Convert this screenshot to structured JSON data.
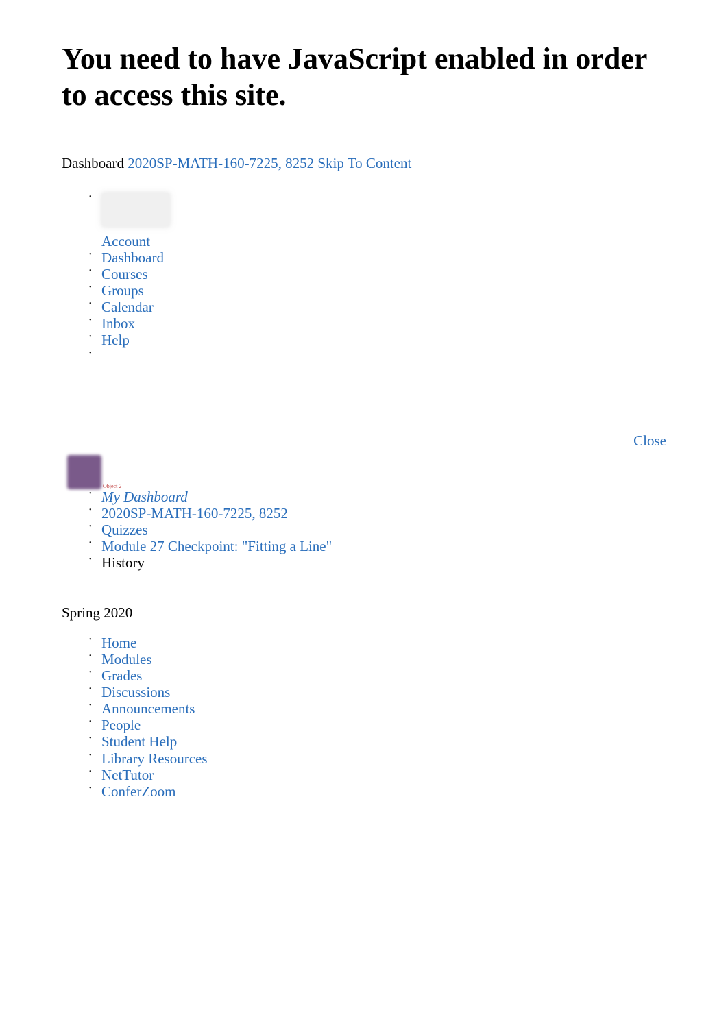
{
  "heading": "You need to have JavaScript enabled in order to access this site.",
  "top_line": {
    "dashboard": "Dashboard",
    "course_code": "2020SP-MATH-160-7225, 8252",
    "skip_link": "Skip To Content"
  },
  "main_nav": {
    "account": "Account",
    "dashboard": "Dashboard",
    "courses": "Courses",
    "groups": "Groups",
    "calendar": "Calendar",
    "inbox": "Inbox",
    "help": "Help"
  },
  "close_label": "Close",
  "object_label": "Object 2",
  "breadcrumb": {
    "my_dashboard": "My Dashboard",
    "course_code": "2020SP-MATH-160-7225, 8252",
    "quizzes": "Quizzes",
    "module_checkpoint": "Module 27 Checkpoint: \"Fitting a Line\"",
    "history": "History"
  },
  "term": "Spring 2020",
  "course_nav": {
    "home": "Home",
    "modules": "Modules",
    "grades": "Grades",
    "discussions": "Discussions",
    "announcements": "Announcements",
    "people": "People",
    "student_help": "Student Help",
    "library_resources": "Library Resources",
    "nettutor": "NetTutor",
    "conferzoom": "ConferZoom"
  }
}
